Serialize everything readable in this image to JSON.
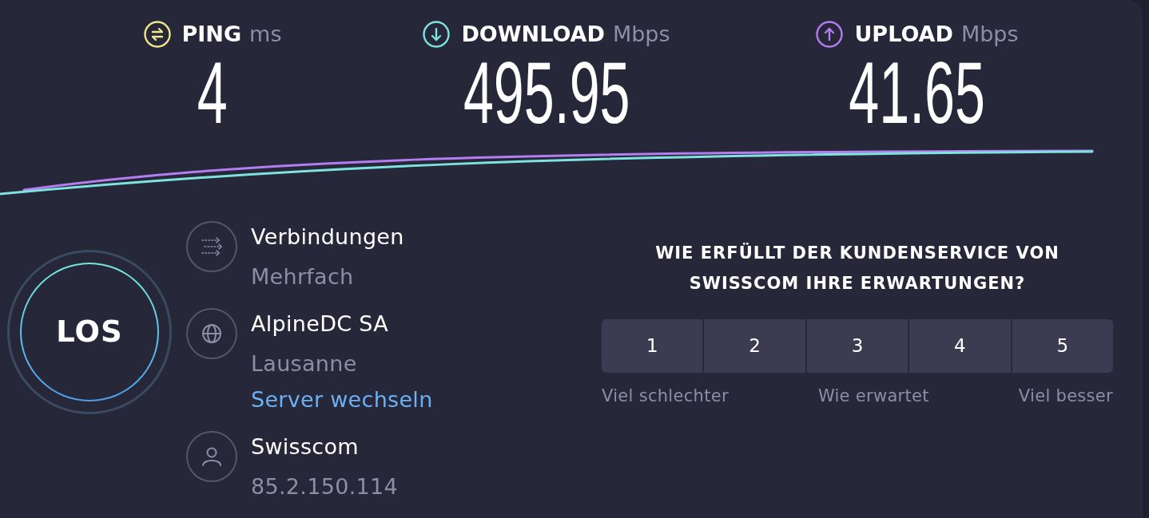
{
  "metrics": [
    {
      "kind": "ping",
      "label": "PING",
      "unit": "ms",
      "value": "4",
      "color": "#efe58a"
    },
    {
      "kind": "download",
      "label": "DOWNLOAD",
      "unit": "Mbps",
      "value": "495.95",
      "color": "#7ee3df"
    },
    {
      "kind": "upload",
      "label": "UPLOAD",
      "unit": "Mbps",
      "value": "41.65",
      "color": "#b47df0"
    }
  ],
  "start_button": {
    "label": "LOS"
  },
  "info": [
    {
      "kind": "connections",
      "title": "Verbindungen",
      "subtitle": "Mehrfach"
    },
    {
      "kind": "server",
      "title": "AlpineDC SA",
      "subtitle": "Lausanne",
      "link": "Server wechseln"
    },
    {
      "kind": "provider",
      "title": "Swisscom",
      "subtitle": "85.2.150.114"
    }
  ],
  "survey": {
    "question": "WIE ERFÜLLT DER KUNDENSERVICE VON SWISSCOM IHRE ERWARTUNGEN?",
    "options": [
      {
        "label": "1",
        "selected": false
      },
      {
        "label": "2",
        "selected": false
      },
      {
        "label": "3",
        "selected": false
      },
      {
        "label": "4",
        "selected": false
      },
      {
        "label": "5",
        "selected": false
      }
    ],
    "scale_labels": [
      "Viel schlechter",
      "Wie erwartet",
      "Viel besser"
    ]
  }
}
